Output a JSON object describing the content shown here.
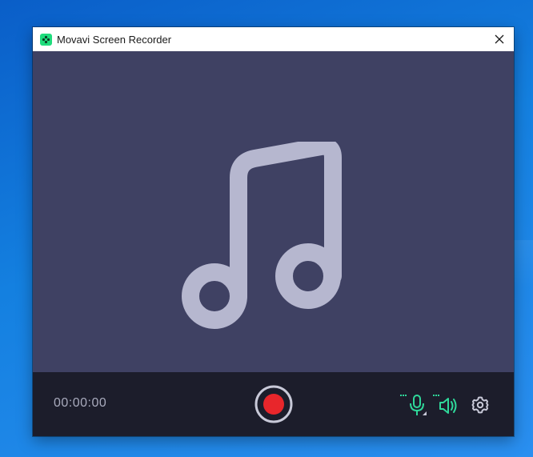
{
  "window": {
    "title": "Movavi Screen Recorder",
    "logo_icon": "movavi-logo-icon",
    "close_icon": "close-icon"
  },
  "preview": {
    "icon": "music-note-icon"
  },
  "controls": {
    "timer": "00:00:00",
    "record_icon": "record-icon",
    "microphone_icon": "microphone-icon",
    "speaker_icon": "speaker-icon",
    "settings_icon": "gear-icon"
  },
  "colors": {
    "preview_bg": "#3f4163",
    "bar_bg": "#1c1d2b",
    "accent_green": "#2fd89a",
    "record_red": "#e8262b",
    "icon_grey": "#b6b7cf"
  }
}
